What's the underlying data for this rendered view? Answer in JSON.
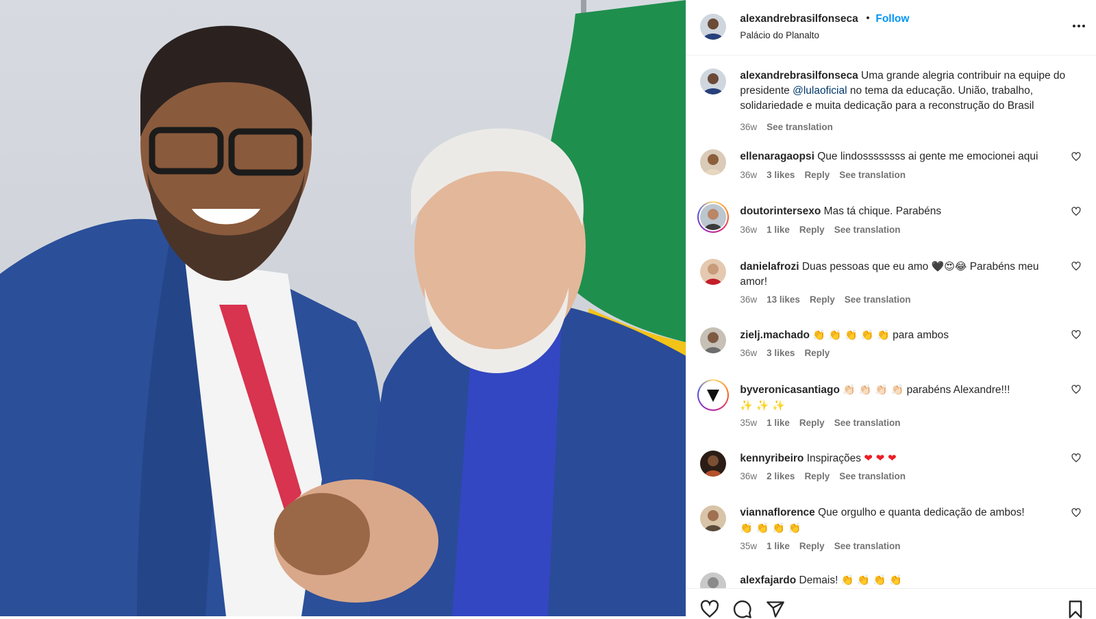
{
  "post": {
    "author": "alexandrebrasilfonseca",
    "separator": "•",
    "follow_label": "Follow",
    "location": "Palácio do Planalto",
    "photo_alt": "",
    "caption": {
      "username": "alexandrebrasilfonseca",
      "text_before": "Uma grande alegria contribuir na equipe do presidente",
      "mention": "@lulaoficial",
      "text_after": "no tema da educação. União, trabalho, solidariedade e muita dedicação para a reconstrução do Brasil",
      "time": "36w",
      "see_translation": "See translation"
    }
  },
  "comments": [
    {
      "username": "ellenaragaopsi",
      "text": "Que lindossssssss ai gente me emocionei aqui",
      "time": "36w",
      "likes": "3 likes",
      "reply": "Reply",
      "translate": "See translation"
    },
    {
      "username": "doutorintersexo",
      "text": "Mas tá chique. Parabéns",
      "time": "36w",
      "likes": "1 like",
      "reply": "Reply",
      "translate": "See translation"
    },
    {
      "username": "danielafrozi",
      "text_a": "Duas pessoas que eu amo",
      "emoji": "🖤😍😂",
      "text_b": "Parabéns meu amor!",
      "time": "36w",
      "likes": "13 likes",
      "reply": "Reply",
      "translate": "See translation"
    },
    {
      "username": "zielj.machado",
      "emoji": "👏 👏 👏 👏 👏",
      "text": "para ambos",
      "time": "36w",
      "likes": "3 likes",
      "reply": "Reply"
    },
    {
      "username": "byveronicasantiago",
      "emoji": "👏🏻 👏🏻 👏🏻 👏🏻",
      "text": "parabéns Alexandre!!!",
      "emoji2": "✨ ✨ ✨",
      "time": "35w",
      "likes": "1 like",
      "reply": "Reply",
      "translate": "See translation"
    },
    {
      "username": "kennyribeiro",
      "text": "Inspirações",
      "emoji": "❤ ❤ ❤",
      "time": "36w",
      "likes": "2 likes",
      "reply": "Reply",
      "translate": "See translation"
    },
    {
      "username": "viannaflorence",
      "text": "Que orgulho e quanta dedicação de ambos!",
      "emoji": "👏 👏 👏 👏",
      "time": "35w",
      "likes": "1 like",
      "reply": "Reply",
      "translate": "See translation"
    },
    {
      "username": "alexfajardo",
      "text": "Demais!",
      "emoji": "👏 👏 👏 👏"
    }
  ],
  "colors": {
    "follow": "#0095f6",
    "mention": "#00376b",
    "meta": "#737373",
    "heart": "#ed1c24"
  },
  "icons": [
    "more-options-icon",
    "like-heart-icon",
    "comment-icon",
    "share-icon",
    "save-icon"
  ]
}
